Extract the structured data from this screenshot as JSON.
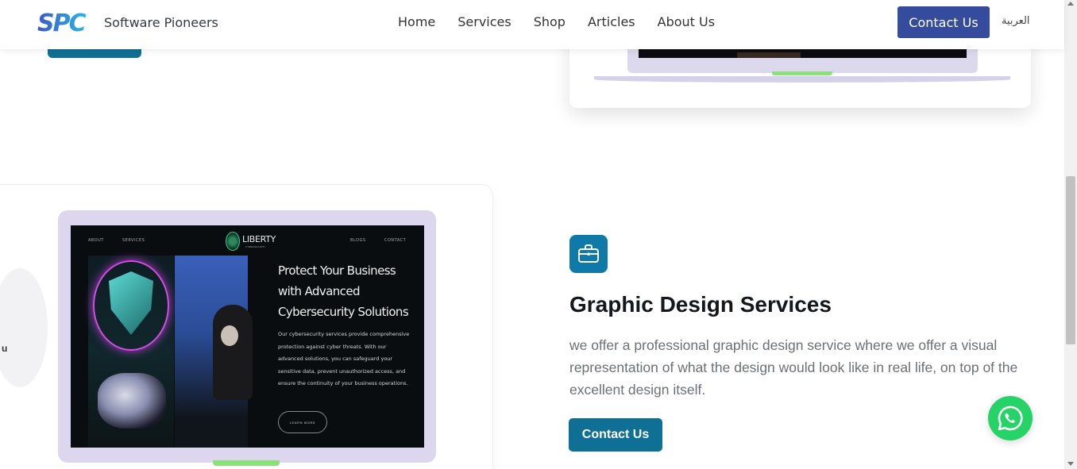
{
  "header": {
    "brand": "Software Pioneers",
    "nav": [
      "Home",
      "Services",
      "Shop",
      "Articles",
      "About Us"
    ],
    "cta_label": "Contact Us",
    "language_label": "العربية"
  },
  "laptop_screen": {
    "nav_left": [
      "ABOUT",
      "SERVICES"
    ],
    "nav_right": [
      "BLOGS",
      "CONTACT"
    ],
    "logo_text": "LIBERTY",
    "logo_subtext": "CYBERSECURITY",
    "title": "Protect Your Business with Advanced Cybersecurity Solutions",
    "body": "Our cybersecurity services provide comprehensive protection against cyber threats. With our advanced solutions, you can safeguard your sensitive data, prevent unauthorized access, and ensure the continuity of your business operations.",
    "button_label": "LEARN MORE"
  },
  "card_side_text": "u",
  "service": {
    "icon": "briefcase-icon",
    "title": "Graphic Design Services",
    "description": "we offer a professional graphic design service where we offer a visual representation of what the design would look like in real life, on top of the excellent design itself.",
    "button_label": "Contact Us"
  },
  "colors": {
    "primary": "#354c9c",
    "teal": "#0f6f95",
    "whatsapp": "#25d366",
    "laptop_frame": "#dcd7ee"
  }
}
